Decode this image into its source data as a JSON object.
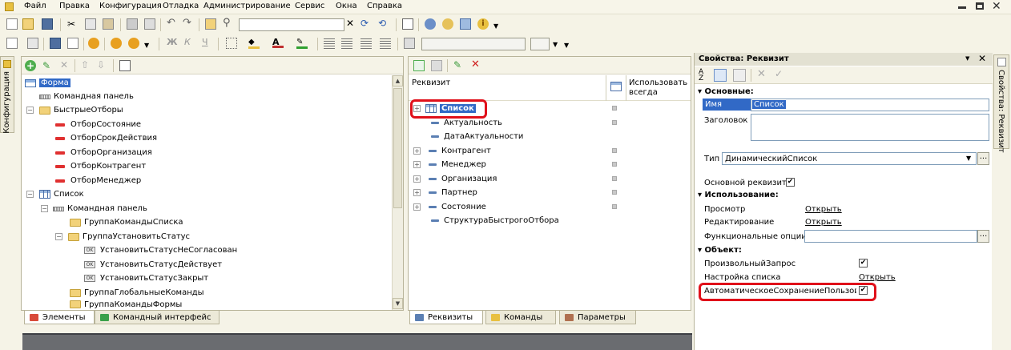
{
  "menu": [
    "Файл",
    "Правка",
    "Конфигурация",
    "Отладка",
    "Администрирование",
    "Сервис",
    "Окна",
    "Справка"
  ],
  "side_tab_left": "Конфигурация",
  "side_tab_right": "Свойства: Реквизит",
  "left_panel": {
    "tree": [
      {
        "label": "Форма",
        "icon": "form-icon",
        "selected": true
      },
      {
        "label": "Командная панель",
        "icon": "command-panel-icon"
      },
      {
        "label": "БыстрыеОтборы",
        "icon": "folder-icon"
      },
      {
        "label": "ОтборСостояние",
        "icon": "field-icon"
      },
      {
        "label": "ОтборСрокДействия",
        "icon": "field-icon"
      },
      {
        "label": "ОтборОрганизация",
        "icon": "field-icon"
      },
      {
        "label": "ОтборКонтрагент",
        "icon": "field-icon"
      },
      {
        "label": "ОтборМенеджер",
        "icon": "field-icon"
      },
      {
        "label": "Список",
        "icon": "table-icon"
      },
      {
        "label": "Командная панель",
        "icon": "command-panel-icon"
      },
      {
        "label": "ГруппаКомандыСписка",
        "icon": "folder-icon"
      },
      {
        "label": "ГруппаУстановитьСтатус",
        "icon": "folder-icon"
      },
      {
        "label": "УстановитьСтатусНеСогласован",
        "icon": "ok-icon"
      },
      {
        "label": "УстановитьСтатусДействует",
        "icon": "ok-icon"
      },
      {
        "label": "УстановитьСтатусЗакрыт",
        "icon": "ok-icon"
      },
      {
        "label": "ГруппаГлобальныеКоманды",
        "icon": "folder-icon"
      },
      {
        "label": "ГруппаКомандыФормы",
        "icon": "folder-icon"
      }
    ],
    "tabs": [
      "Элементы",
      "Командный интерфейс"
    ]
  },
  "middle_panel": {
    "col_header": "Реквизит",
    "col_use_always": "Использовать всегда",
    "rows": [
      {
        "label": "Список",
        "selected": true
      },
      {
        "label": "Актуальность"
      },
      {
        "label": "ДатаАктуальности"
      },
      {
        "label": "Контрагент"
      },
      {
        "label": "Менеджер"
      },
      {
        "label": "Организация"
      },
      {
        "label": "Партнер"
      },
      {
        "label": "Состояние"
      },
      {
        "label": "СтруктураБыстрогоОтбора"
      }
    ],
    "tabs": [
      "Реквизиты",
      "Команды",
      "Параметры"
    ]
  },
  "properties": {
    "title": "Свойства: Реквизит",
    "sec_main": "Основные:",
    "name_label": "Имя",
    "name_value": "Список",
    "caption_label": "Заголовок",
    "type_label": "Тип",
    "type_value": "ДинамическийСписок",
    "main_attr_label": "Основной реквизит",
    "sec_usage": "Использование:",
    "view_label": "Просмотр",
    "view_link": "Открыть",
    "edit_label": "Редактирование",
    "edit_link": "Открыть",
    "func_label": "Функциональные опции",
    "sec_object": "Объект:",
    "custom_query_label": "ПроизвольныйЗапрос",
    "list_settings_label": "Настройка списка",
    "list_settings_link": "Открыть",
    "autosave_label": "АвтоматическоеСохранениеПользова"
  },
  "colors": {
    "selection": "#3169c6",
    "highlight": "#e0101a",
    "background": "#f5f3e7"
  }
}
